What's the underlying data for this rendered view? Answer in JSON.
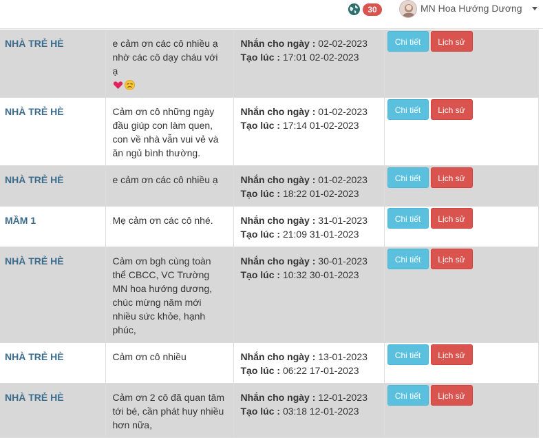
{
  "header": {
    "notification_count": "30",
    "user_name": "MN Hoa Hướng Dương"
  },
  "labels": {
    "sent_for": "Nhắn cho ngày :",
    "created_at": "Tạo lúc :",
    "detail_button": "Chi tiết",
    "history_button": "Lịch sử"
  },
  "rows": [
    {
      "class_name": "NHÀ TRẺ HÈ",
      "message": "e cảm ơn các cô nhiều ạ nhờ các cô dạy cháu với ạ",
      "emojis": [
        "heart",
        "sad-face"
      ],
      "sent_for": "02-02-2023",
      "created_at": "17:01 02-02-2023"
    },
    {
      "class_name": "NHÀ TRẺ HÈ",
      "message": "Cảm ơn cô những ngày đầu giúp con làm quen, con về nhà vẫn vui vẻ và ăn ngủ bình thường.",
      "emojis": [],
      "sent_for": "01-02-2023",
      "created_at": "17:14 01-02-2023"
    },
    {
      "class_name": "NHÀ TRẺ HÈ",
      "message": "e cảm ơn các cô nhiều ạ",
      "emojis": [],
      "sent_for": "01-02-2023",
      "created_at": "18:22 01-02-2023"
    },
    {
      "class_name": "MẦM 1",
      "message": "Mẹ cảm ơn các cô nhé.",
      "emojis": [],
      "sent_for": "31-01-2023",
      "created_at": "21:09 31-01-2023"
    },
    {
      "class_name": "NHÀ TRẺ HÈ",
      "message": "Cảm ơn bgh cùng toàn thể CBCC, VC Trường MN hoa hướng dương, chúc mừng năm mới nhiều sức khỏe, hạnh phúc,",
      "emojis": [],
      "sent_for": "30-01-2023",
      "created_at": "10:32 30-01-2023"
    },
    {
      "class_name": "NHÀ TRẺ HÈ",
      "message": "Cảm ơn cô nhiều",
      "emojis": [],
      "sent_for": "13-01-2023",
      "created_at": "06:22 17-01-2023"
    },
    {
      "class_name": "NHÀ TRẺ HÈ",
      "message": "Cảm ơn 2 cô đã quan tâm tới bé, cần phát huy nhiều hơn nữa,",
      "emojis": [],
      "sent_for": "12-01-2023",
      "created_at": "03:18 12-01-2023"
    }
  ]
}
